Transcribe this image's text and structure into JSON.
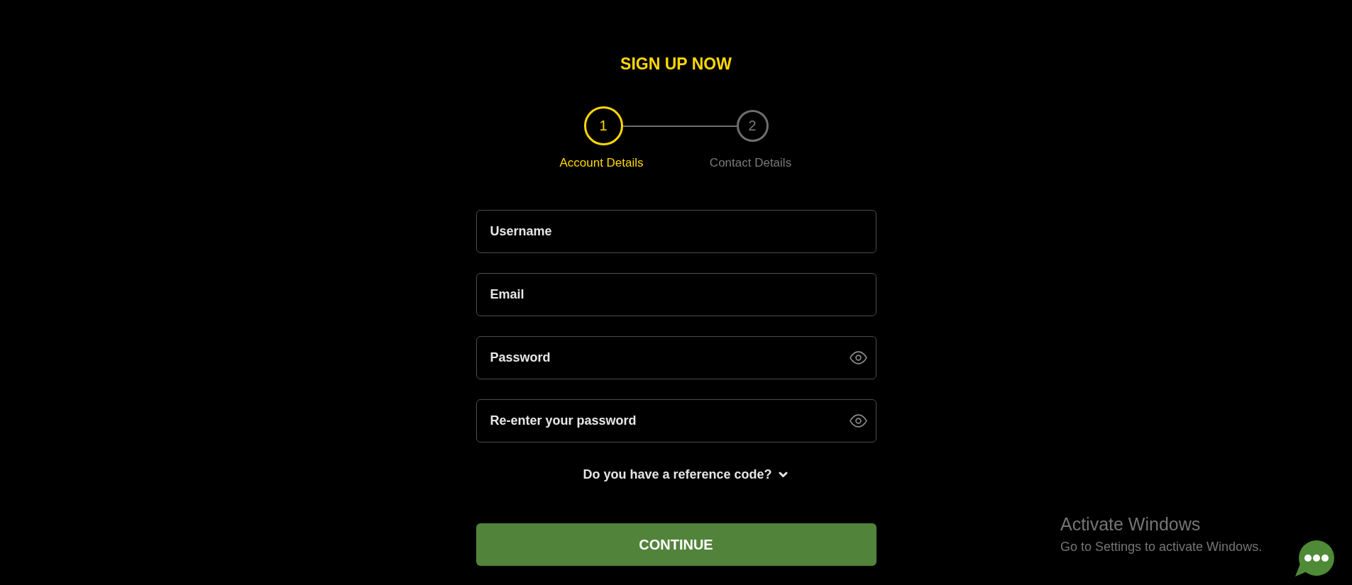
{
  "title": "SIGN UP NOW",
  "steps": [
    {
      "number": "1",
      "label": "Account Details",
      "selected": true
    },
    {
      "number": "2",
      "label": "Contact Details",
      "selected": false
    }
  ],
  "fields": [
    {
      "kind": "text",
      "placeholder": "Username"
    },
    {
      "kind": "text",
      "placeholder": "Email"
    },
    {
      "kind": "password",
      "placeholder": "Password"
    },
    {
      "kind": "password",
      "placeholder": "Re-enter your password"
    }
  ],
  "reference_code": {
    "label": "Do you have a reference code?",
    "expanded": false
  },
  "continue_button": {
    "label": "CONTINUE"
  },
  "activation_notice": {
    "title": "Activate Windows",
    "message": "Go to Settings to activate Windows."
  }
}
